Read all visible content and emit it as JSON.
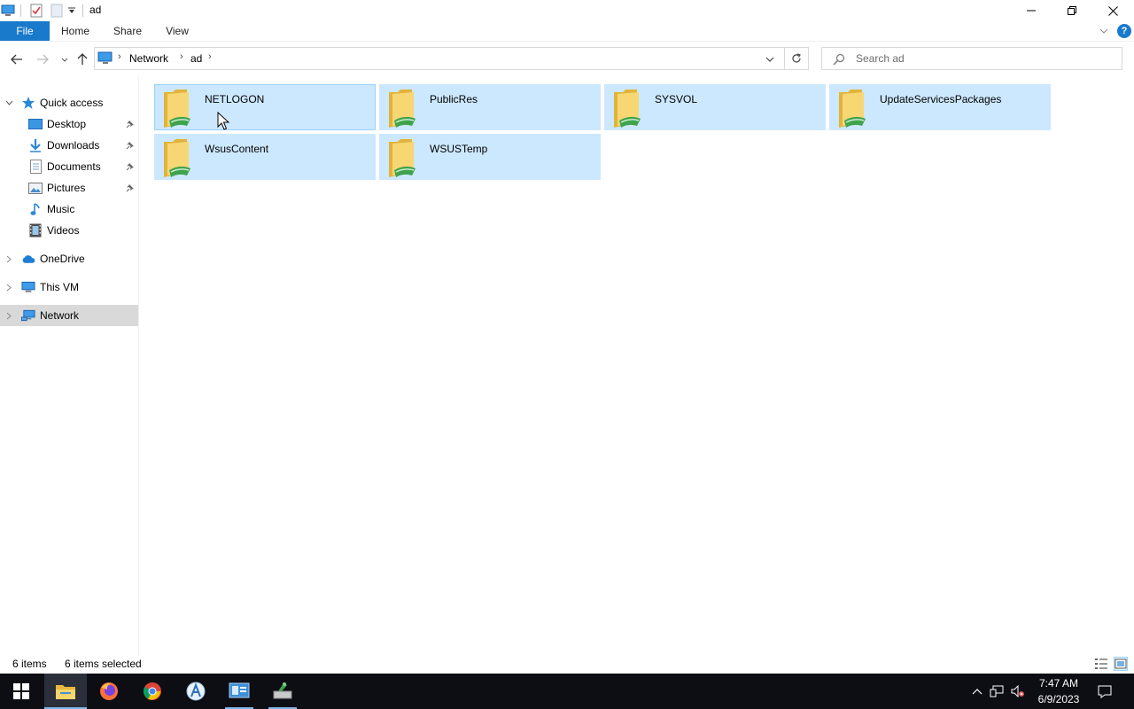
{
  "window": {
    "title": "ad",
    "minimize_icon": "minimize-icon",
    "maximize_icon": "restore-icon",
    "close_icon": "close-icon"
  },
  "ribbon": {
    "tabs": [
      {
        "label": "File",
        "active": true
      },
      {
        "label": "Home"
      },
      {
        "label": "Share"
      },
      {
        "label": "View"
      }
    ],
    "help_label": "?"
  },
  "address": {
    "breadcrumb": [
      "Network",
      "ad"
    ],
    "separator": "›"
  },
  "search": {
    "placeholder": "Search ad",
    "value": ""
  },
  "sidebar": {
    "quick_access": {
      "label": "Quick access",
      "icon": "star-icon"
    },
    "quick_items": [
      {
        "label": "Desktop",
        "icon": "desktop-folder-icon",
        "pinned": true
      },
      {
        "label": "Downloads",
        "icon": "download-arrow-icon",
        "pinned": true
      },
      {
        "label": "Documents",
        "icon": "document-icon",
        "pinned": true
      },
      {
        "label": "Pictures",
        "icon": "pictures-icon",
        "pinned": true
      },
      {
        "label": "Music",
        "icon": "music-note-icon",
        "pinned": false
      },
      {
        "label": "Videos",
        "icon": "film-icon",
        "pinned": false
      }
    ],
    "onedrive": {
      "label": "OneDrive",
      "icon": "cloud-icon"
    },
    "this_vm": {
      "label": "This VM",
      "icon": "computer-icon"
    },
    "network": {
      "label": "Network",
      "icon": "network-icon",
      "selected": true
    }
  },
  "content": {
    "items": [
      {
        "name": "NETLOGON",
        "selected": true,
        "focused": true
      },
      {
        "name": "PublicRes",
        "selected": true
      },
      {
        "name": "SYSVOL",
        "selected": true
      },
      {
        "name": "UpdateServicesPackages",
        "selected": true
      },
      {
        "name": "WsusContent",
        "selected": true
      },
      {
        "name": "WSUSTemp",
        "selected": true
      }
    ],
    "item_icon": "shared-folder-icon"
  },
  "status": {
    "count": "6 items",
    "selected": "6 items selected",
    "active_view": "tiles"
  },
  "taskbar": {
    "apps": [
      "start-icon",
      "file-explorer-icon",
      "firefox-icon",
      "chrome-icon",
      "wizard-icon",
      "server-manager-icon",
      "admin-tools-icon"
    ],
    "time": "7:47 AM",
    "date": "6/9/2023"
  },
  "colors": {
    "accent": "#1979ca",
    "selection": "#cce8ff",
    "selection_border": "#99d1ff",
    "taskbar": "#0d0d14"
  }
}
